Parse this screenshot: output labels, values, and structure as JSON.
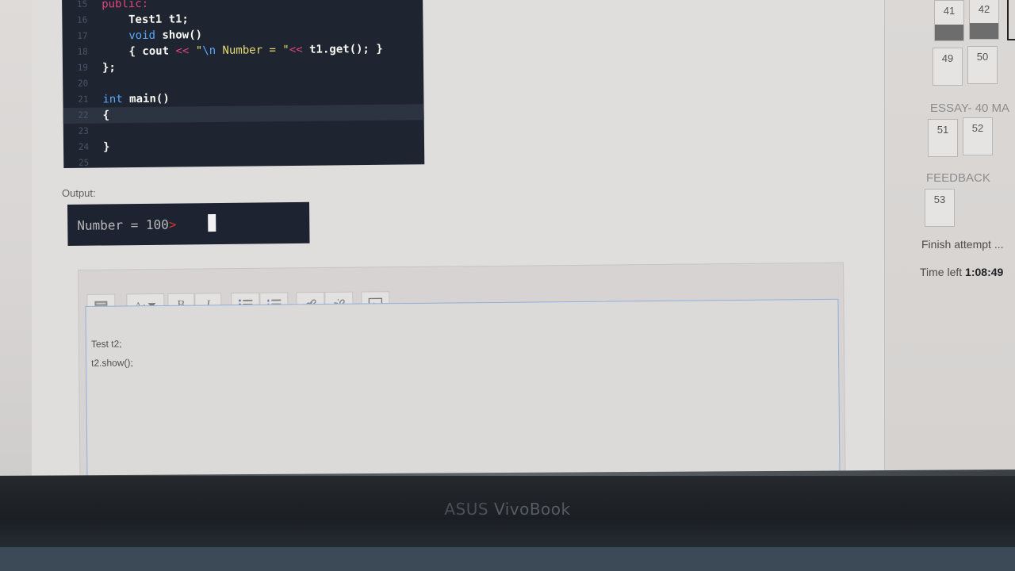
{
  "code": {
    "lines": [
      {
        "n": "15",
        "parts": [
          {
            "t": "public:",
            "c": "kw"
          }
        ]
      },
      {
        "n": "16",
        "parts": [
          {
            "t": "    Test1 t1;",
            "c": "fn"
          }
        ]
      },
      {
        "n": "17",
        "parts": [
          {
            "t": "    ",
            "c": ""
          },
          {
            "t": "void",
            "c": "ty"
          },
          {
            "t": " show()",
            "c": "fn"
          }
        ]
      },
      {
        "n": "18",
        "parts": [
          {
            "t": "    { cout ",
            "c": "fn"
          },
          {
            "t": "<<",
            "c": "op"
          },
          {
            "t": " \"",
            "c": "st"
          },
          {
            "t": "\\n",
            "c": "ty"
          },
          {
            "t": " Number = \"",
            "c": "st"
          },
          {
            "t": "<<",
            "c": "op"
          },
          {
            "t": " t1.get(); }",
            "c": "fn"
          }
        ]
      },
      {
        "n": "19",
        "parts": [
          {
            "t": "};",
            "c": "fn"
          }
        ]
      },
      {
        "n": "20",
        "parts": []
      },
      {
        "n": "21",
        "parts": [
          {
            "t": "int",
            "c": "ty"
          },
          {
            "t": " main()",
            "c": "fn"
          }
        ]
      },
      {
        "n": "22",
        "parts": [
          {
            "t": "{",
            "c": "fn"
          }
        ]
      },
      {
        "n": "23",
        "parts": []
      },
      {
        "n": "24",
        "parts": [
          {
            "t": "}",
            "c": "fn"
          }
        ]
      },
      {
        "n": "25",
        "parts": []
      }
    ]
  },
  "output": {
    "label": "Output:",
    "text": "Number = 100",
    "prompt": ">"
  },
  "editor": {
    "line1": "Test t2;",
    "line2": "t2.show();"
  },
  "toolbar": {
    "font_label": "A",
    "bold": "B",
    "italic": "I"
  },
  "nav": {
    "questions_top": [
      "41",
      "42"
    ],
    "questions_mid": [
      "49",
      "50"
    ],
    "essay_heading": "ESSAY- 40 MA",
    "essay_questions": [
      "51",
      "52"
    ],
    "feedback_heading": "FEEDBACK",
    "feedback_questions": [
      "53"
    ],
    "finish_attempt": "Finish attempt ...",
    "time_left_label": "Time left",
    "time_left_value": "1:08:49"
  },
  "brand": {
    "part1": "ASUS",
    "part2": "VivoBook"
  }
}
